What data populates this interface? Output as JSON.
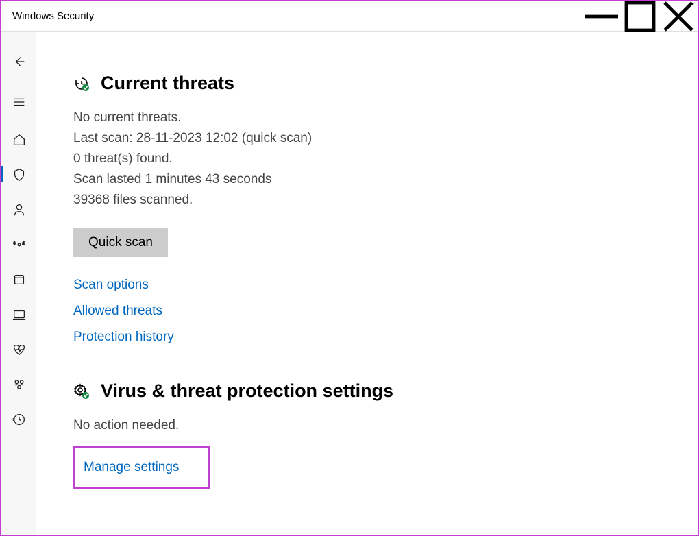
{
  "window": {
    "title": "Windows Security"
  },
  "sections": {
    "threats": {
      "heading": "Current threats",
      "no_threats": "No current threats.",
      "last_scan": "Last scan: 28-11-2023 12:02 (quick scan)",
      "found": "0 threat(s) found.",
      "duration": "Scan lasted 1 minutes 43 seconds",
      "files": "39368 files scanned.",
      "quick_scan_btn": "Quick scan",
      "links": {
        "scan_options": "Scan options",
        "allowed": "Allowed threats",
        "history": "Protection history"
      }
    },
    "settings": {
      "heading": "Virus & threat protection settings",
      "status": "No action needed.",
      "manage": "Manage settings"
    }
  }
}
